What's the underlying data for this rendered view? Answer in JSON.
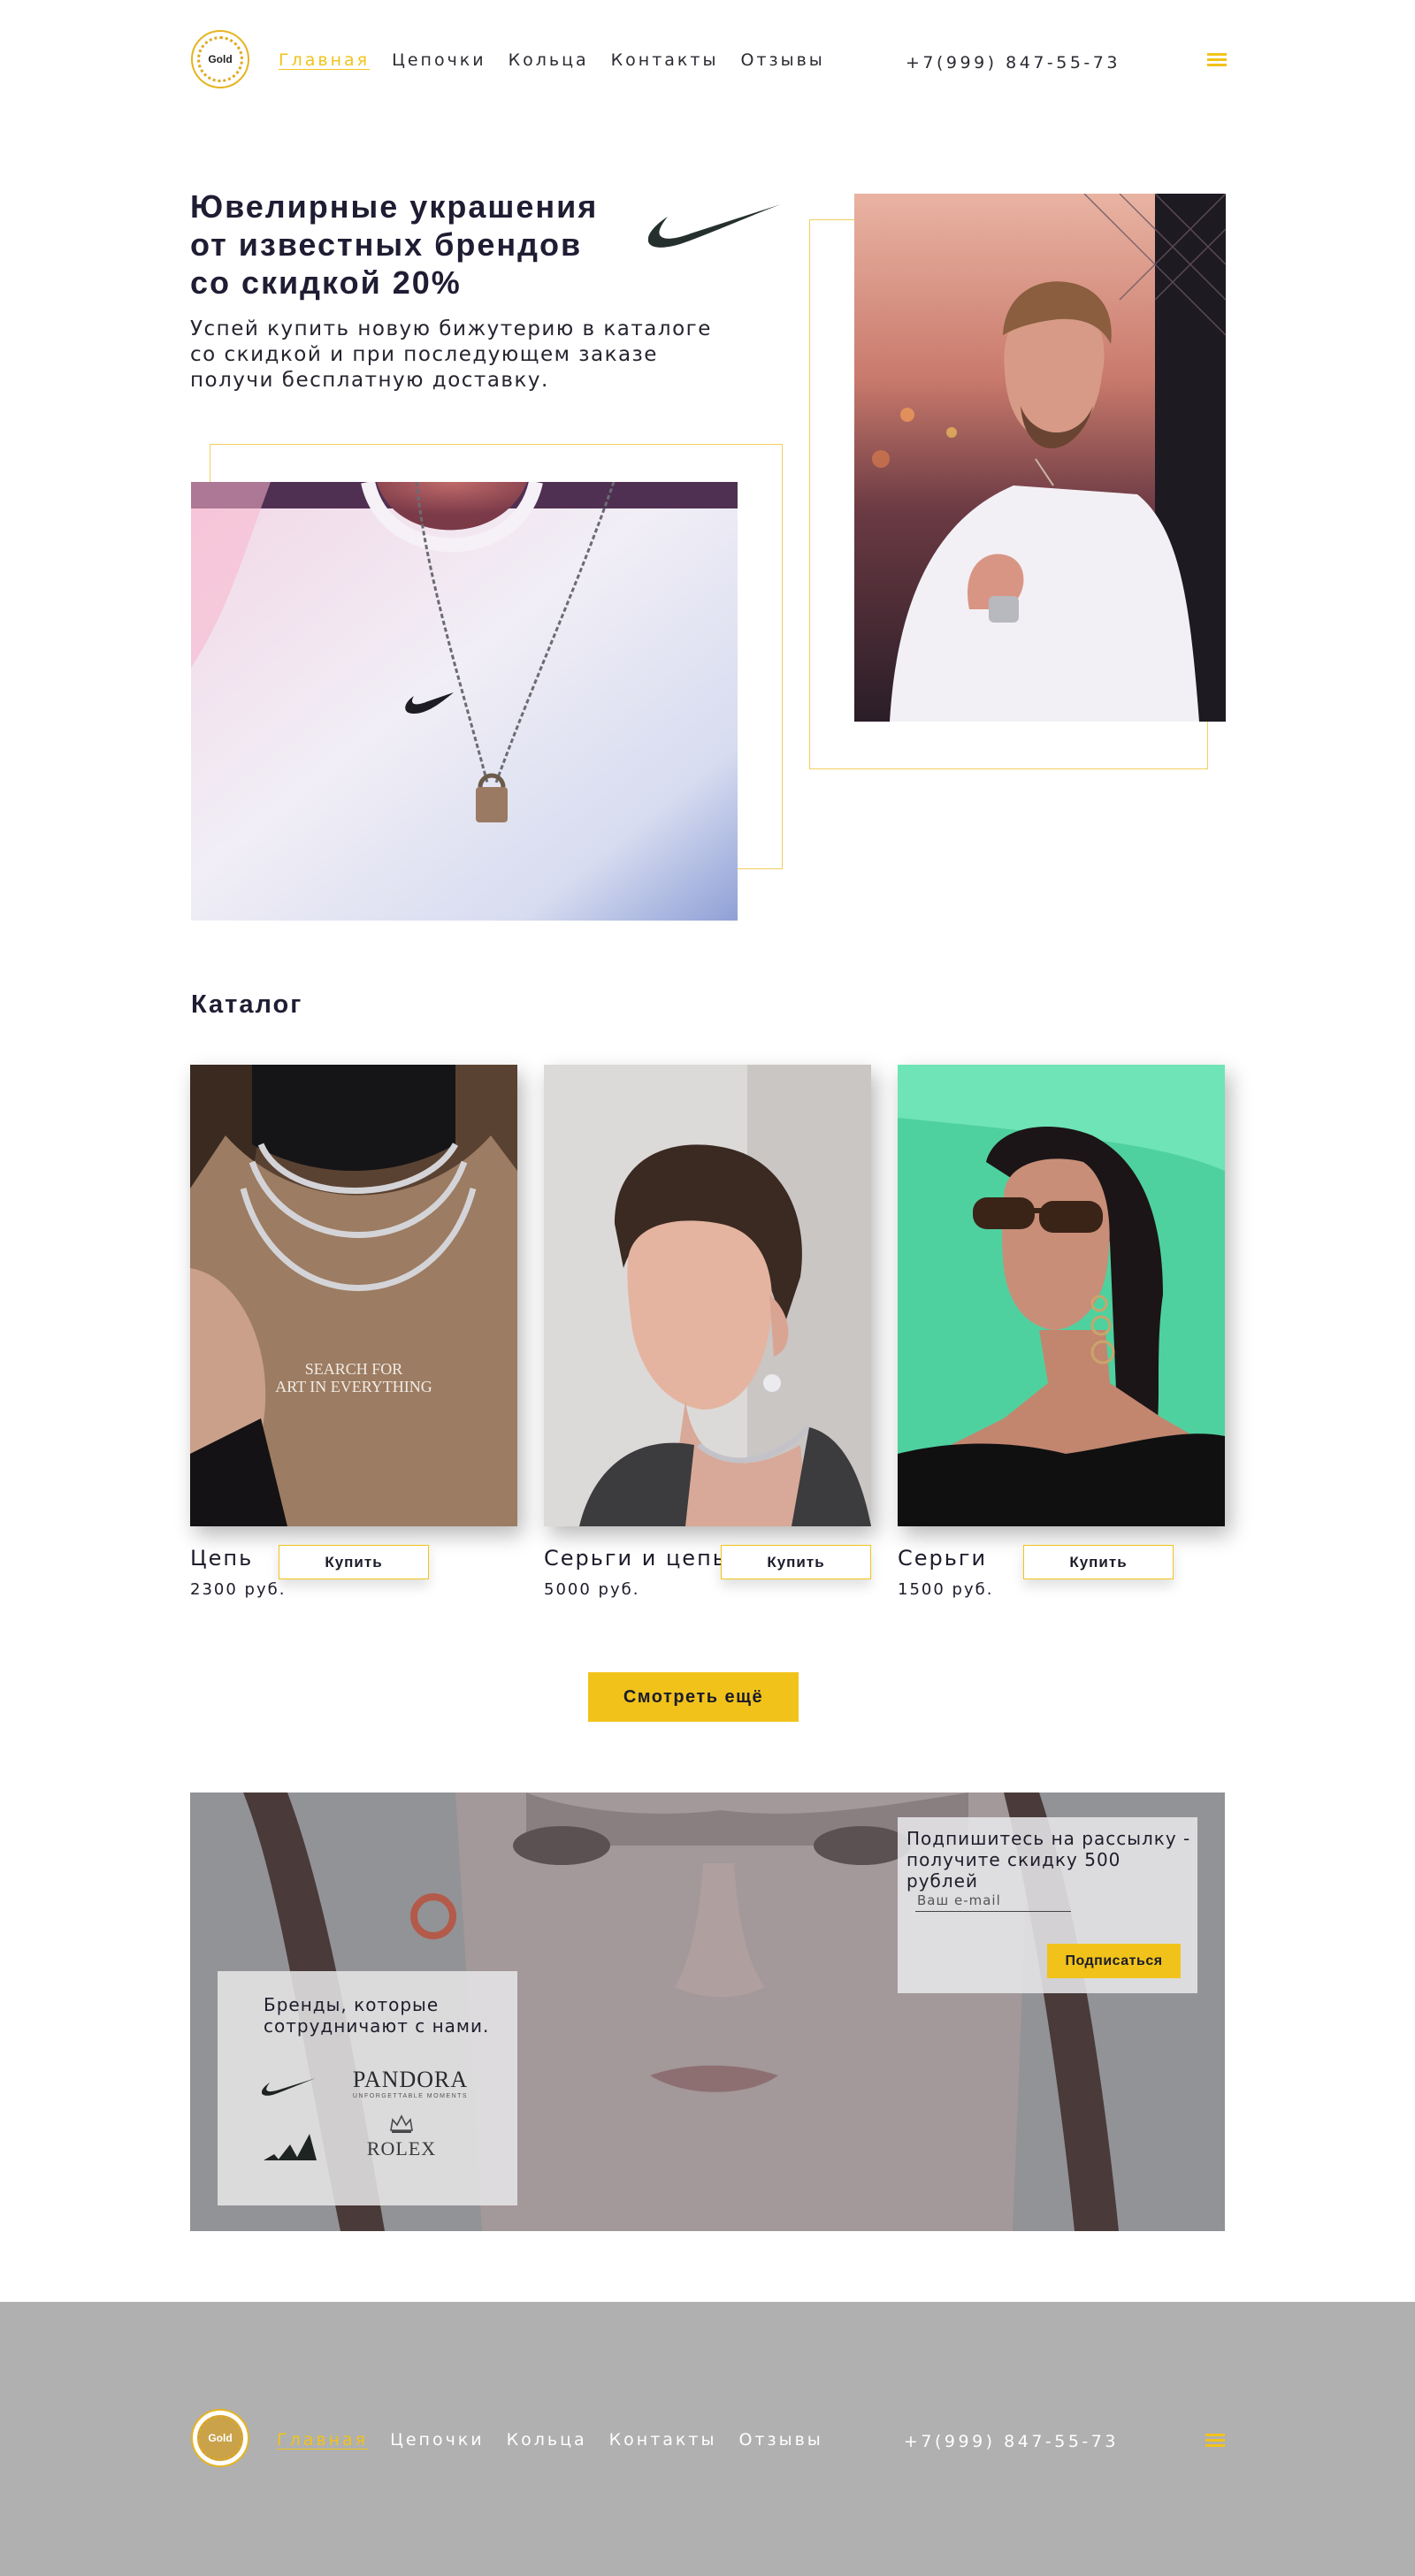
{
  "header": {
    "logo_text": "Gold",
    "nav": [
      "Главная",
      "Цепочки",
      "Кольца",
      "Контакты",
      "Отзывы"
    ],
    "phone": "+7(999) 847-55-73"
  },
  "hero": {
    "title_lines": [
      "Ювелирные украшения",
      "от известных брендов",
      "со скидкой 20%"
    ],
    "subtitle_lines": [
      "Успей купить новую бижутерию в каталоге",
      "со скидкой и при последующем заказе",
      "получи бесплатную доставку."
    ],
    "brand_logo": "nike-swoosh"
  },
  "catalog": {
    "title": "Каталог",
    "buy_label": "Купить",
    "items": [
      {
        "name": "Цепь",
        "price": "2300 руб.",
        "print_text_1": "SEARCH FOR",
        "print_text_2": "ART IN EVERYTHING"
      },
      {
        "name": "Серьги и цепь",
        "price": "5000 руб."
      },
      {
        "name": "Серьги",
        "price": "1500 руб."
      }
    ],
    "more_label": "Смотреть ещё"
  },
  "promo": {
    "brands_text_lines": [
      "Бренды, которые",
      "сотрудничают с нами."
    ],
    "brands": [
      "Nike",
      "PANDORA",
      "adidas",
      "ROLEX"
    ],
    "pandora_tagline": "UNFORGETTABLE MOMENTS",
    "subscribe_text_lines": [
      "Подпишитесь на рассылку -",
      "получите скидку 500 рублей"
    ],
    "email_placeholder": "Ваш e-mail",
    "subscribe_label": "Подписаться"
  },
  "footer": {
    "logo_text": "Gold",
    "nav": [
      "Главная",
      "Цепочки",
      "Кольца",
      "Контакты",
      "Отзывы"
    ],
    "phone": "+7(999) 847-55-73"
  },
  "colors": {
    "accent": "#f1c31a",
    "text": "#1f1d33",
    "footer_bg": "#b0b0b0"
  }
}
